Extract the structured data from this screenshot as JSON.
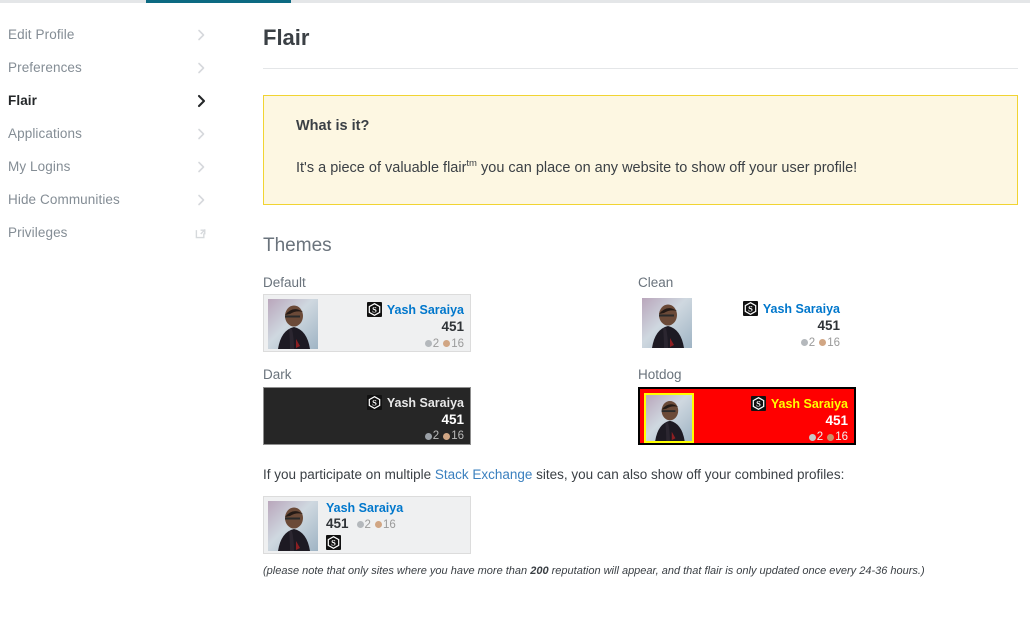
{
  "sidebar": {
    "items": [
      {
        "label": "Edit Profile",
        "icon": "chevron-right-icon",
        "active": false
      },
      {
        "label": "Preferences",
        "icon": "chevron-right-icon",
        "active": false
      },
      {
        "label": "Flair",
        "icon": "chevron-right-icon",
        "active": true
      },
      {
        "label": "Applications",
        "icon": "chevron-right-icon",
        "active": false
      },
      {
        "label": "My Logins",
        "icon": "chevron-right-icon",
        "active": false
      },
      {
        "label": "Hide Communities",
        "icon": "chevron-right-icon",
        "active": false
      },
      {
        "label": "Privileges",
        "icon": "external-link-icon",
        "active": false
      }
    ]
  },
  "main": {
    "title": "Flair",
    "notice": {
      "heading": "What is it?",
      "text_before": "It's a piece of valuable flair",
      "superscript": "tm",
      "text_after": " you can place on any website to show off your user profile!"
    },
    "themes_heading": "Themes",
    "themes": [
      {
        "name": "Default",
        "key": "t-default"
      },
      {
        "name": "Clean",
        "key": "t-clean"
      },
      {
        "name": "Dark",
        "key": "t-dark"
      },
      {
        "name": "Hotdog",
        "key": "t-hotdog"
      }
    ],
    "flair": {
      "username": "Yash Saraiya",
      "reputation": "451",
      "silver_badges": "2",
      "bronze_badges": "16",
      "site_icon": "stack-exchange-icon"
    },
    "combined": {
      "intro_before": "If you participate on multiple ",
      "intro_link": "Stack Exchange",
      "intro_after": " sites, you can also show off your combined profiles:",
      "footnote_before": "(please note that only sites where you have more than ",
      "footnote_bold": "200",
      "footnote_after": " reputation will appear, and that flair is only updated once every 24-36 hours.)"
    }
  },
  "colors": {
    "accent_bar": "#0c6a82",
    "notice_border": "#f1d432",
    "notice_background": "#fdf7e2",
    "link": "#0077cc",
    "silver_badge": "#b4b8bc",
    "bronze_badge": "#d1a684",
    "hotdog_background": "#ff0000",
    "hotdog_name": "#ffff00",
    "dark_background": "#262626"
  }
}
